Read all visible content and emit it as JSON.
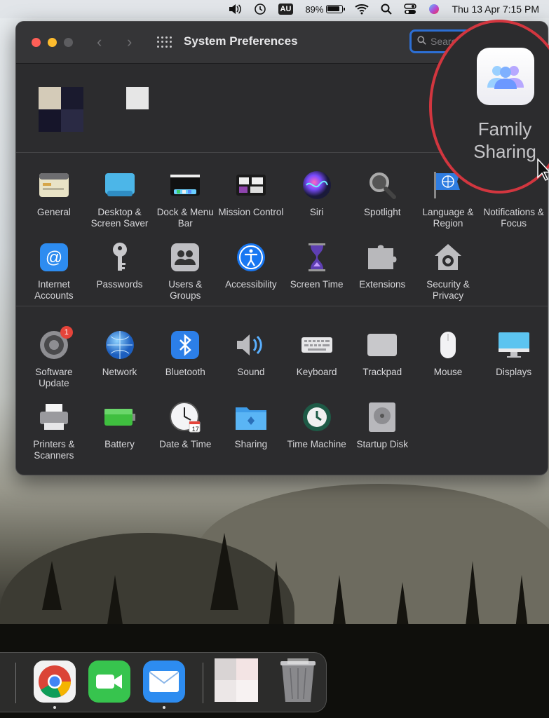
{
  "menubar": {
    "keyboard_input": "AU",
    "battery_percent": "89%",
    "datetime": "Thu 13 Apr  7:15 PM",
    "icons": [
      "volume-icon",
      "time-machine-icon",
      "keyboard-input-icon",
      "battery-icon",
      "wifi-icon",
      "spotlight-icon",
      "control-center-icon",
      "siri-icon"
    ]
  },
  "window": {
    "title": "System Preferences",
    "search_placeholder": "Search"
  },
  "panes_row1": [
    {
      "label": "General",
      "icon": "general-icon"
    },
    {
      "label": "Desktop & Screen Saver",
      "icon": "desktop-icon"
    },
    {
      "label": "Dock & Menu Bar",
      "icon": "dock-icon"
    },
    {
      "label": "Mission Control",
      "icon": "mission-control-icon"
    },
    {
      "label": "Siri",
      "icon": "siri-icon"
    },
    {
      "label": "Spotlight",
      "icon": "spotlight-icon"
    },
    {
      "label": "Language & Region",
      "icon": "language-icon"
    },
    {
      "label": "Notifications & Focus",
      "icon": "notifications-icon"
    }
  ],
  "panes_row2": [
    {
      "label": "Internet Accounts",
      "icon": "at-icon"
    },
    {
      "label": "Passwords",
      "icon": "key-icon"
    },
    {
      "label": "Users & Groups",
      "icon": "users-icon"
    },
    {
      "label": "Accessibility",
      "icon": "accessibility-icon"
    },
    {
      "label": "Screen Time",
      "icon": "hourglass-icon"
    },
    {
      "label": "Extensions",
      "icon": "puzzle-icon"
    },
    {
      "label": "Security & Privacy",
      "icon": "house-lock-icon"
    }
  ],
  "panes_row3": [
    {
      "label": "Software Update",
      "icon": "gear-icon",
      "badge": "1"
    },
    {
      "label": "Network",
      "icon": "globe-icon"
    },
    {
      "label": "Bluetooth",
      "icon": "bluetooth-icon"
    },
    {
      "label": "Sound",
      "icon": "speaker-icon"
    },
    {
      "label": "Keyboard",
      "icon": "keyboard-icon"
    },
    {
      "label": "Trackpad",
      "icon": "trackpad-icon"
    },
    {
      "label": "Mouse",
      "icon": "mouse-icon"
    },
    {
      "label": "Displays",
      "icon": "display-icon"
    }
  ],
  "panes_row4": [
    {
      "label": "Printers & Scanners",
      "icon": "printer-icon"
    },
    {
      "label": "Battery",
      "icon": "battery-icon"
    },
    {
      "label": "Date & Time",
      "icon": "clock-icon",
      "date_badge": "17"
    },
    {
      "label": "Sharing",
      "icon": "folder-icon"
    },
    {
      "label": "Time Machine",
      "icon": "time-machine-icon"
    },
    {
      "label": "Startup Disk",
      "icon": "disk-icon"
    }
  ],
  "highlight": {
    "label": "Family Sharing",
    "icon": "family-sharing-icon",
    "ring_color": "#d2363f"
  },
  "dock": {
    "apps": [
      {
        "name": "Chrome",
        "icon": "chrome-icon",
        "running": true
      },
      {
        "name": "FaceTime",
        "icon": "facetime-icon",
        "running": false
      },
      {
        "name": "Mail",
        "icon": "mail-icon",
        "running": true
      },
      {
        "name": "Trash",
        "icon": "trash-icon",
        "running": false
      }
    ]
  }
}
